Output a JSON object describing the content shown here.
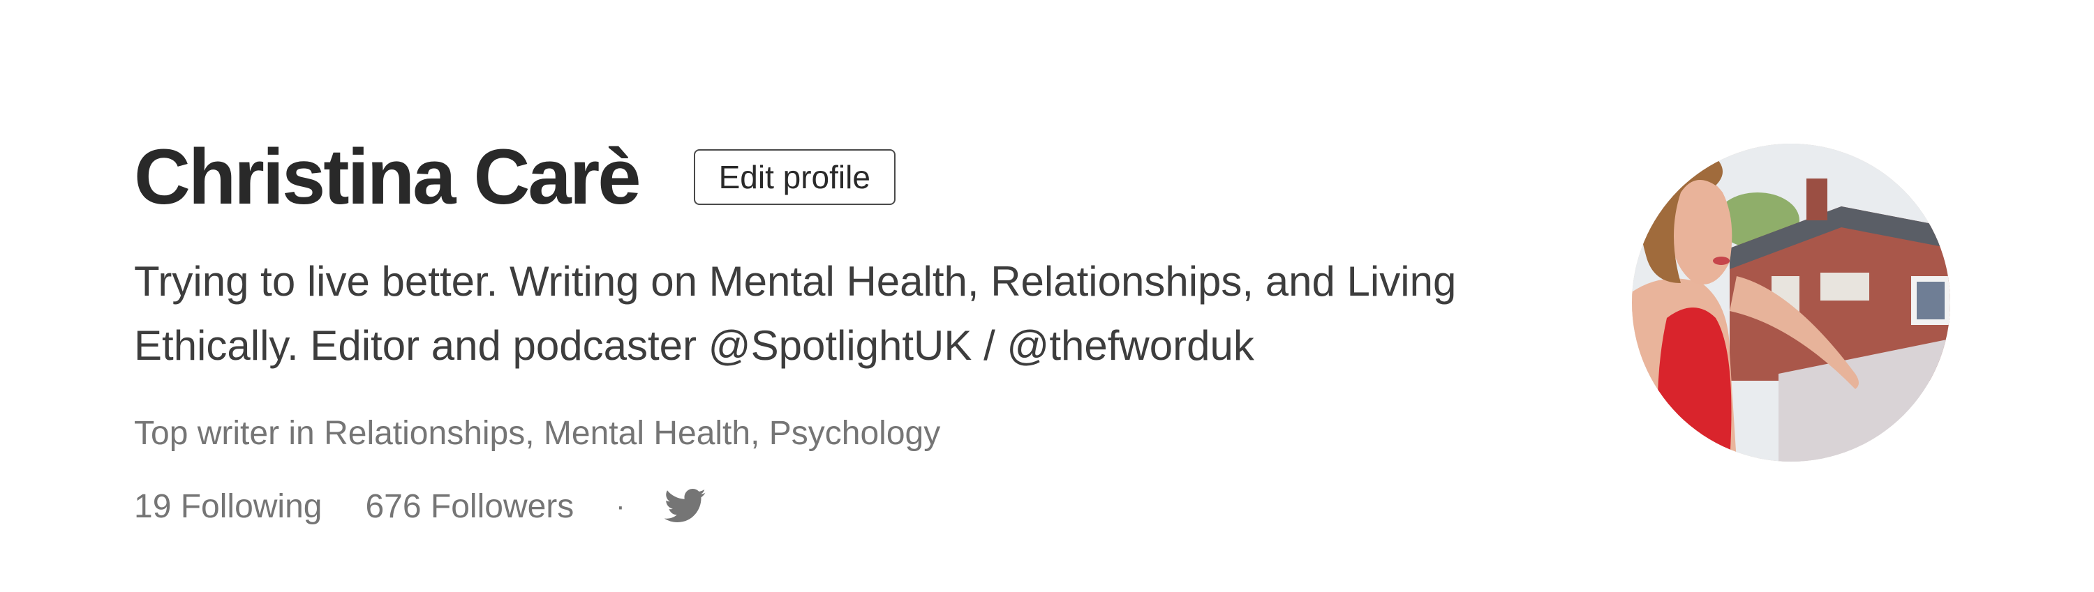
{
  "profile": {
    "name": "Christina Carè",
    "edit_label": "Edit profile",
    "bio": "Trying to live better. Writing on Mental Health, Relationships, and Living Ethically. Editor and podcaster @SpotlightUK / @thefworduk",
    "top_writer": "Top writer in Relationships, Mental Health, Psychology",
    "following": "19 Following",
    "followers": "676 Followers",
    "separator": "·"
  },
  "icons": {
    "social": "twitter-icon",
    "avatar": "profile-photo"
  }
}
